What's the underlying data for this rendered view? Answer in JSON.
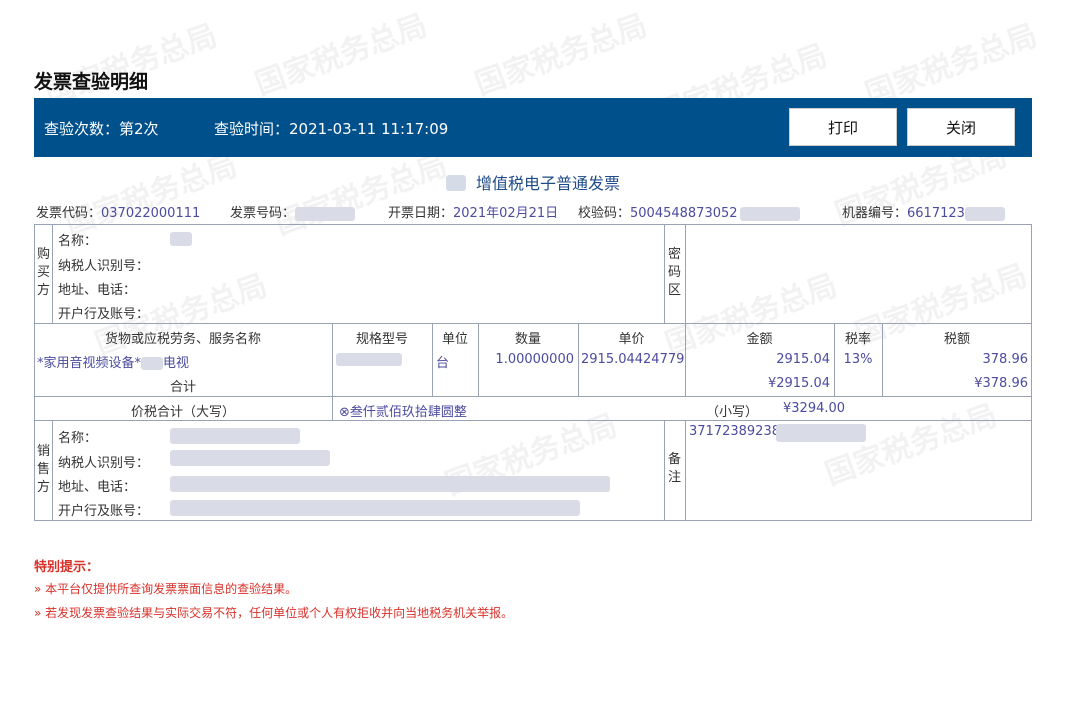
{
  "page": {
    "title": "发票查验明细",
    "watermark": "国家税务总局"
  },
  "header_bar": {
    "check_count_label": "查验次数：第2次",
    "check_time_label": "查验时间：2021-03-11 11:17:09",
    "print_label": "打印",
    "close_label": "关闭"
  },
  "invoice": {
    "type_title": "增值税电子普通发票",
    "code_label": "发票代码：",
    "code_value": "037022000111",
    "number_label": "发票号码：",
    "date_label": "开票日期：",
    "date_value": "2021年02月21日",
    "check_code_label": "校验码：",
    "check_code_value": "5004548873052",
    "machine_label": "机器编号：",
    "machine_value": "6617123"
  },
  "buyer": {
    "section_label": "购买方",
    "name_label": "名称：",
    "tax_id_label": "纳税人识别号：",
    "address_label": "地址、电话：",
    "bank_label": "开户行及账号："
  },
  "cipher_label": "密码区",
  "items_header": {
    "name": "货物或应税劳务、服务名称",
    "spec": "规格型号",
    "unit": "单位",
    "qty": "数量",
    "price": "单价",
    "amount": "金额",
    "rate": "税率",
    "tax": "税额"
  },
  "items": [
    {
      "name_prefix": "*家用音视频设备*",
      "name_suffix": "电视",
      "unit": "台",
      "qty": "1.00000000",
      "price": "2915.04424779",
      "amount": "2915.04",
      "rate": "13%",
      "tax": "378.96"
    }
  ],
  "subtotal": {
    "label": "合计",
    "amount": "¥2915.04",
    "tax": "¥378.96"
  },
  "total": {
    "label": "价税合计（大写）",
    "words": "⊗叁仟贰佰玖拾肆圆整",
    "small_label": "（小写）",
    "small_value": "¥3294.00"
  },
  "seller": {
    "section_label": "销售方",
    "name_label": "名称：",
    "tax_id_label": "纳税人识别号：",
    "address_label": "地址、电话：",
    "bank_label": "开户行及账号："
  },
  "remark": {
    "label": "备注",
    "value": "37172389238"
  },
  "notes": {
    "heading": "特别提示：",
    "items": [
      "»  本平台仅提供所查询发票票面信息的查验结果。",
      "»  若发现发票查验结果与实际交易不符，任何单位或个人有权拒收并向当地税务机关举报。"
    ]
  },
  "colors": {
    "bar": "#00508c",
    "value": "#4b4ba0",
    "notice": "#d9312a"
  }
}
